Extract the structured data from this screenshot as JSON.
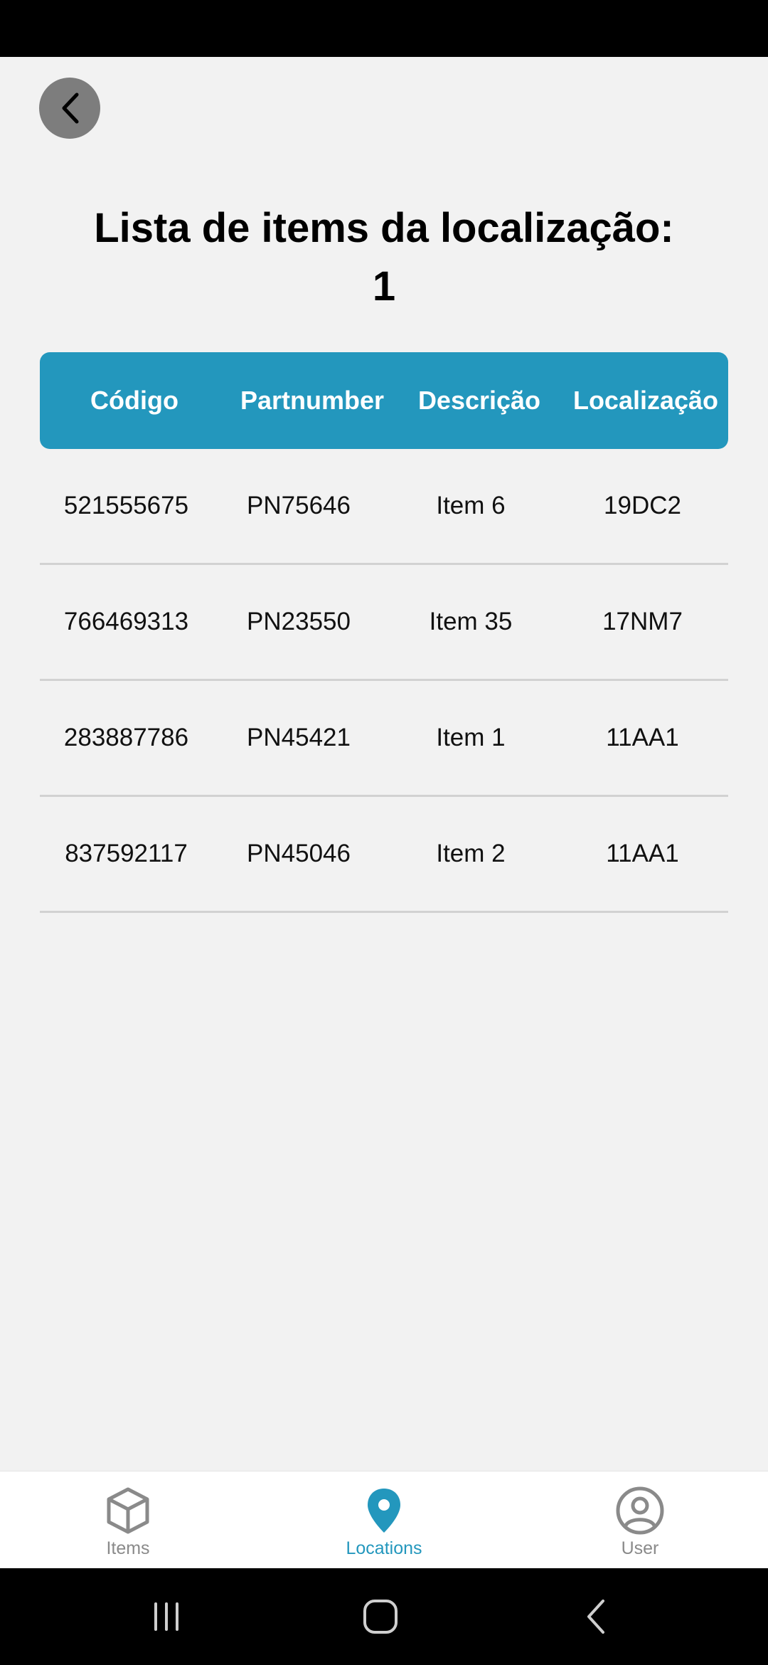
{
  "screen": {
    "title_line1": "Lista de items da localização:",
    "title_line2": "1"
  },
  "table": {
    "headers": [
      "Código",
      "Partnumber",
      "Descrição",
      "Localização"
    ],
    "rows": [
      [
        "521555675",
        "PN75646",
        "Item 6",
        "19DC2"
      ],
      [
        "766469313",
        "PN23550",
        "Item 35",
        "17NM7"
      ],
      [
        "283887786",
        "PN45421",
        "Item 1",
        "11AA1"
      ],
      [
        "837592117",
        "PN45046",
        "Item 2",
        "11AA1"
      ]
    ]
  },
  "nav": {
    "items": [
      {
        "label": "Items",
        "icon": "cube-icon",
        "active": false
      },
      {
        "label": "Locations",
        "icon": "location-pin-icon",
        "active": true
      },
      {
        "label": "User",
        "icon": "user-circle-icon",
        "active": false
      }
    ]
  },
  "colors": {
    "accent": "#2397bd",
    "background": "#f2f2f2",
    "inactive": "#8a8a8a",
    "back_button": "#7d7d7d"
  }
}
